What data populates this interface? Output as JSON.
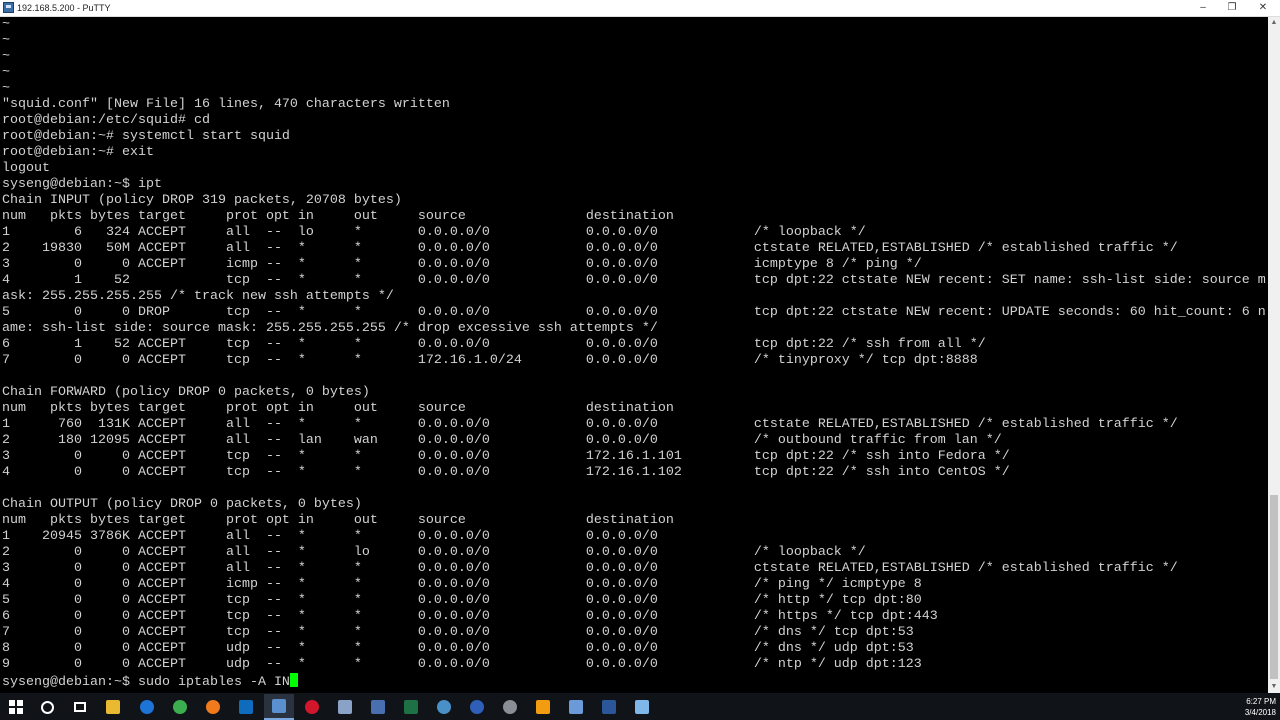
{
  "window": {
    "title": "192.168.5.200 - PuTTY",
    "min_glyph": "–",
    "max_glyph": "❐",
    "close_glyph": "✕"
  },
  "terminal": {
    "lines": [
      "~",
      "~",
      "~",
      "~",
      "~",
      "\"squid.conf\" [New File] 16 lines, 470 characters written",
      "root@debian:/etc/squid# cd",
      "root@debian:~# systemctl start squid",
      "root@debian:~# exit",
      "logout",
      "syseng@debian:~$ ipt",
      "Chain INPUT (policy DROP 319 packets, 20708 bytes)",
      "num   pkts bytes target     prot opt in     out     source               destination",
      "1        6   324 ACCEPT     all  --  lo     *       0.0.0.0/0            0.0.0.0/0            /* loopback */",
      "2    19830   50M ACCEPT     all  --  *      *       0.0.0.0/0            0.0.0.0/0            ctstate RELATED,ESTABLISHED /* established traffic */",
      "3        0     0 ACCEPT     icmp --  *      *       0.0.0.0/0            0.0.0.0/0            icmptype 8 /* ping */",
      "4        1    52            tcp  --  *      *       0.0.0.0/0            0.0.0.0/0            tcp dpt:22 ctstate NEW recent: SET name: ssh-list side: source m",
      "ask: 255.255.255.255 /* track new ssh attempts */",
      "5        0     0 DROP       tcp  --  *      *       0.0.0.0/0            0.0.0.0/0            tcp dpt:22 ctstate NEW recent: UPDATE seconds: 60 hit_count: 6 n",
      "ame: ssh-list side: source mask: 255.255.255.255 /* drop excessive ssh attempts */",
      "6        1    52 ACCEPT     tcp  --  *      *       0.0.0.0/0            0.0.0.0/0            tcp dpt:22 /* ssh from all */",
      "7        0     0 ACCEPT     tcp  --  *      *       172.16.1.0/24        0.0.0.0/0            /* tinyproxy */ tcp dpt:8888",
      "",
      "Chain FORWARD (policy DROP 0 packets, 0 bytes)",
      "num   pkts bytes target     prot opt in     out     source               destination",
      "1      760  131K ACCEPT     all  --  *      *       0.0.0.0/0            0.0.0.0/0            ctstate RELATED,ESTABLISHED /* established traffic */",
      "2      180 12095 ACCEPT     all  --  lan    wan     0.0.0.0/0            0.0.0.0/0            /* outbound traffic from lan */",
      "3        0     0 ACCEPT     tcp  --  *      *       0.0.0.0/0            172.16.1.101         tcp dpt:22 /* ssh into Fedora */",
      "4        0     0 ACCEPT     tcp  --  *      *       0.0.0.0/0            172.16.1.102         tcp dpt:22 /* ssh into CentOS */",
      "",
      "Chain OUTPUT (policy DROP 0 packets, 0 bytes)",
      "num   pkts bytes target     prot opt in     out     source               destination",
      "1    20945 3786K ACCEPT     all  --  *      *       0.0.0.0/0            0.0.0.0/0",
      "2        0     0 ACCEPT     all  --  *      lo      0.0.0.0/0            0.0.0.0/0            /* loopback */",
      "3        0     0 ACCEPT     all  --  *      *       0.0.0.0/0            0.0.0.0/0            ctstate RELATED,ESTABLISHED /* established traffic */",
      "4        0     0 ACCEPT     icmp --  *      *       0.0.0.0/0            0.0.0.0/0            /* ping */ icmptype 8",
      "5        0     0 ACCEPT     tcp  --  *      *       0.0.0.0/0            0.0.0.0/0            /* http */ tcp dpt:80",
      "6        0     0 ACCEPT     tcp  --  *      *       0.0.0.0/0            0.0.0.0/0            /* https */ tcp dpt:443",
      "7        0     0 ACCEPT     tcp  --  *      *       0.0.0.0/0            0.0.0.0/0            /* dns */ tcp dpt:53",
      "8        0     0 ACCEPT     udp  --  *      *       0.0.0.0/0            0.0.0.0/0            /* dns */ udp dpt:53",
      "9        0     0 ACCEPT     udp  --  *      *       0.0.0.0/0            0.0.0.0/0            /* ntp */ udp dpt:123"
    ],
    "prompt": "syseng@debian:~$ sudo iptables -A IN",
    "cursor_color": "#00ff00"
  },
  "taskbar": {
    "apps": [
      {
        "icon": "edge-browser-icon",
        "color": "#1e73d6"
      },
      {
        "icon": "chrome-browser-icon",
        "color": "#3cae4f"
      },
      {
        "icon": "firefox-browser-icon",
        "color": "#f07a1c"
      },
      {
        "icon": "outlook-icon",
        "color": "#0f6cbd"
      },
      {
        "icon": "putty-icon",
        "color": "#5a8fd0"
      },
      {
        "icon": "opera-icon",
        "color": "#d2162c"
      },
      {
        "icon": "putty-config-icon",
        "color": "#8aa2c8"
      },
      {
        "icon": "keepass-icon",
        "color": "#4a6fb0"
      },
      {
        "icon": "excel-icon",
        "color": "#1e7145"
      },
      {
        "icon": "network-globe-icon",
        "color": "#4a90c8"
      },
      {
        "icon": "vpn-icon",
        "color": "#2f5fb8"
      },
      {
        "icon": "steam-icon",
        "color": "#8a8f96"
      },
      {
        "icon": "vlc-icon",
        "color": "#f39c12"
      },
      {
        "icon": "virtualbox-icon",
        "color": "#6a9bd8"
      },
      {
        "icon": "word-icon",
        "color": "#2b579a"
      },
      {
        "icon": "notepad-icon",
        "color": "#7fb7e8"
      }
    ],
    "clock_time": "6:27 PM",
    "clock_date": "3/4/2018"
  }
}
